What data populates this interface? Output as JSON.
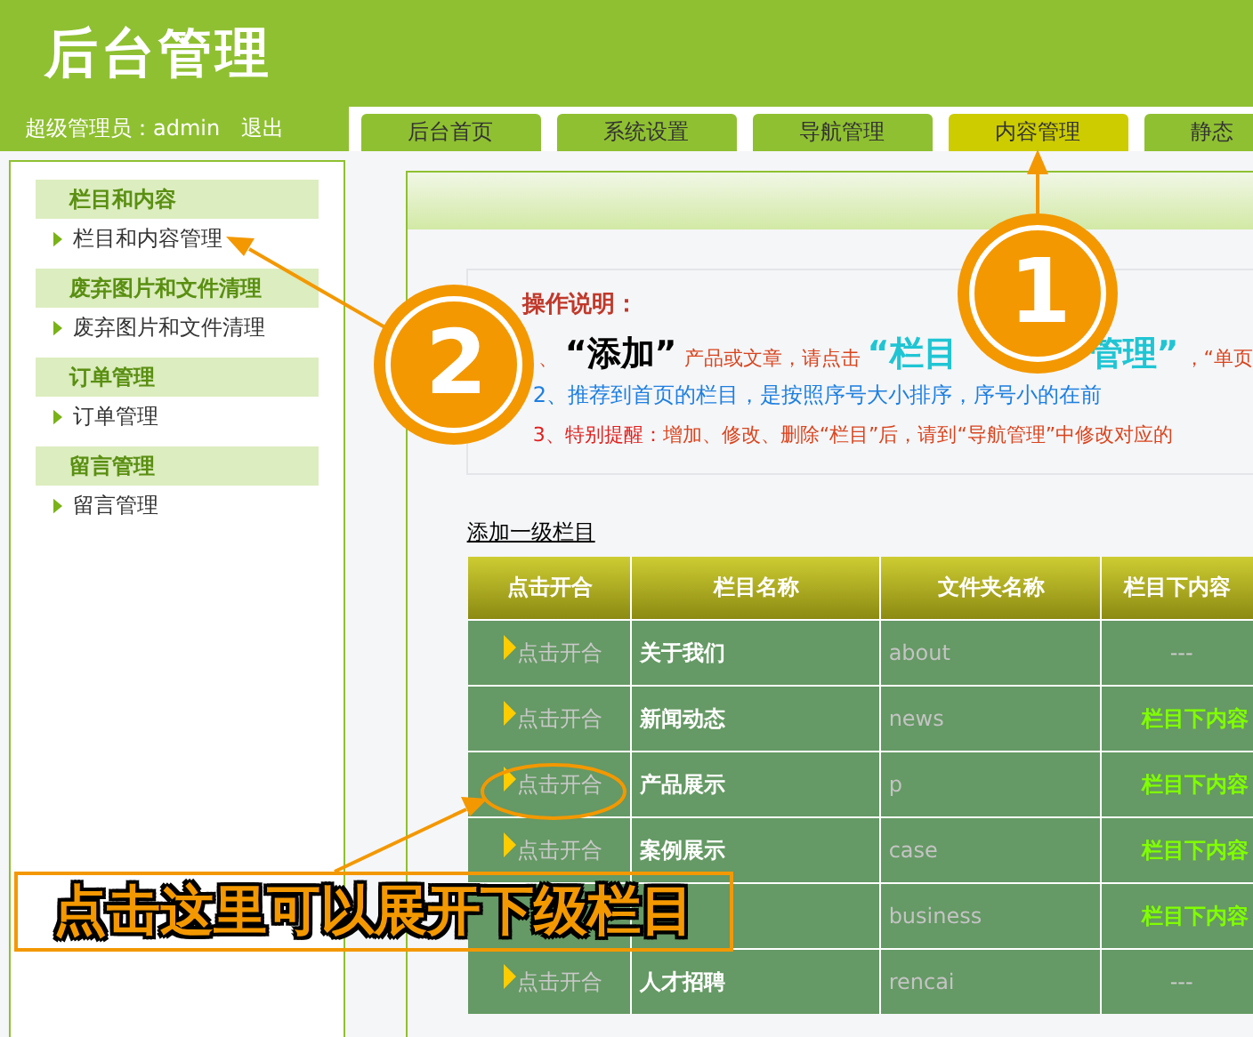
{
  "header": {
    "title": "后台管理",
    "user": "超级管理员：admin",
    "logout": "退出"
  },
  "tabs": [
    {
      "label": "后台首页",
      "selected": false
    },
    {
      "label": "系统设置",
      "selected": false
    },
    {
      "label": "导航管理",
      "selected": false
    },
    {
      "label": "内容管理",
      "selected": true
    },
    {
      "label": "静态",
      "selected": false
    }
  ],
  "sidebar": [
    {
      "heading": "栏目和内容",
      "items": [
        "栏目和内容管理"
      ]
    },
    {
      "heading": "废弃图片和文件清理",
      "items": [
        "废弃图片和文件清理"
      ]
    },
    {
      "heading": "订单管理",
      "items": [
        "订单管理"
      ]
    },
    {
      "heading": "留言管理",
      "items": [
        "留言管理"
      ]
    }
  ],
  "instructions": {
    "title": "操作说明：",
    "lines": [
      [
        {
          "text": "、",
          "kind": "body"
        },
        {
          "text": "“添加”",
          "kind": "keyword"
        },
        {
          "text": "产品或文章，请点击",
          "kind": "body"
        },
        {
          "text": "“栏目",
          "kind": "highlight"
        },
        {
          "text": "管理”",
          "kind": "highlight-tail"
        },
        {
          "text": "，“单页",
          "kind": "body"
        }
      ],
      [
        {
          "text": "2、推荐到首页的栏目，是按照序号大小排序，序号小的在前",
          "kind": "info"
        }
      ],
      [
        {
          "text": "3、特别提醒：",
          "kind": "warning"
        },
        {
          "text": "增加、修改、删除“栏目”后，请到“导航管理”中修改对应的",
          "kind": "body"
        }
      ]
    ]
  },
  "add_link": "添加一级栏目",
  "table": {
    "columns": [
      "点击开合",
      "栏目名称",
      "文件夹名称",
      "栏目下内容"
    ],
    "rows": [
      {
        "toggle": "点击开合",
        "name": "关于我们",
        "folder": "about",
        "content": "---",
        "kind": "empty"
      },
      {
        "toggle": "点击开合",
        "name": "新闻动态",
        "folder": "news",
        "content": "栏目下内容",
        "kind": "link"
      },
      {
        "toggle": "点击开合",
        "name": "产品展示",
        "folder": "p",
        "content": "栏目下内容",
        "kind": "link"
      },
      {
        "toggle": "点击开合",
        "name": "案例展示",
        "folder": "case",
        "content": "栏目下内容",
        "kind": "link"
      },
      {
        "folder": "business",
        "content": "栏目下内容",
        "kind": "link"
      },
      {
        "toggle": "点击开合",
        "name": "人才招聘",
        "folder": "rencai",
        "content": "---",
        "kind": "empty"
      }
    ]
  },
  "annotations": {
    "markers": [
      "1",
      "2"
    ],
    "callout": "点击这里可以展开下级栏目"
  }
}
